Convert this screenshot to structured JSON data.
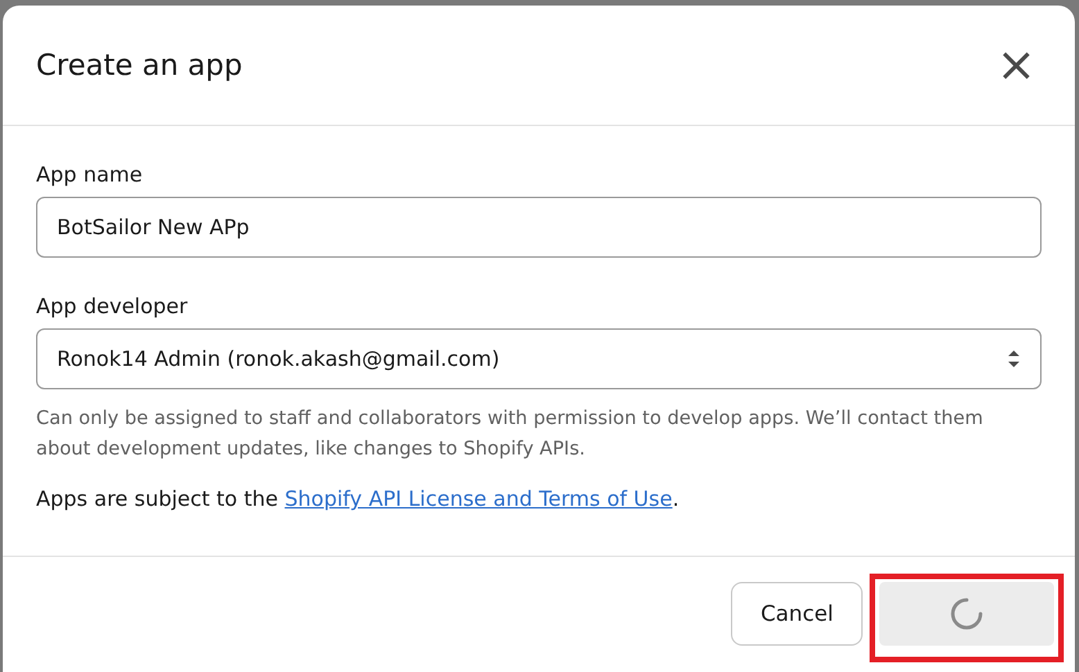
{
  "dialog": {
    "title": "Create an app",
    "close_label": "×"
  },
  "fields": [
    {
      "kind": "text",
      "label": "App name",
      "value": "BotSailor New APp"
    },
    {
      "kind": "select",
      "label": "App developer",
      "value": "Ronok14 Admin (ronok.akash@gmail.com)",
      "help": "Can only be assigned to staff and collaborators with permission to develop apps. We’ll contact them about development updates, like changes to Shopify APIs."
    }
  ],
  "terms": {
    "text": "Apps are subject to the ",
    "link": "Shopify API License and Terms of Use",
    "suffix": "."
  },
  "footer": {
    "cancel": "Cancel",
    "primary_loading": true,
    "highlighted": true
  }
}
